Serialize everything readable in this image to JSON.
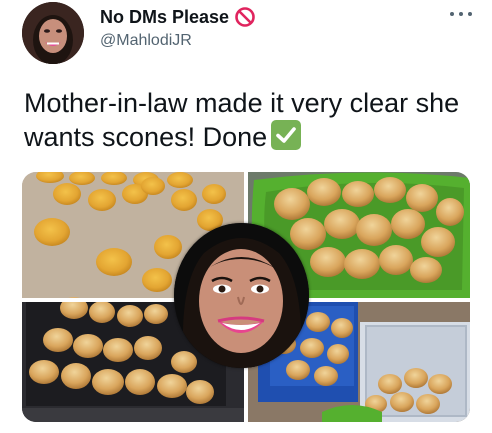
{
  "tweet": {
    "author": {
      "display_name": "No DMs Please",
      "handle": "@MahlodiJR",
      "avatar_icon": "profile-photo",
      "name_emoji": "no-entry-sign-icon"
    },
    "text": "Mother-in-law made it very clear she wants scones! Done",
    "text_emoji": "check-mark-button-icon",
    "more_icon": "more-options-icon",
    "media": {
      "layout": "collage-3-panels",
      "description_icons": [
        "scones-on-baking-tray",
        "scones-in-green-bowl",
        "scones-on-tray-and-containers"
      ],
      "overlay": "profile-photo-circle"
    }
  },
  "colors": {
    "name": "#0f1419",
    "handle": "#536471",
    "no_sign": "#e0245e",
    "check": "#77b255"
  }
}
